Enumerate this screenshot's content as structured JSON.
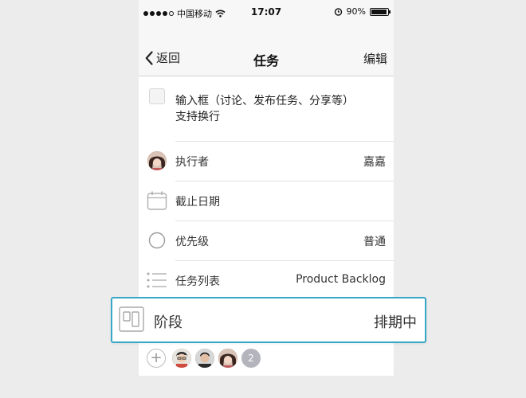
{
  "status_bar": {
    "carrier": "中国移动",
    "time": "17:07",
    "battery": "90%",
    "icons": [
      "signal-dots-icon",
      "wifi-icon",
      "alarm-icon",
      "battery-icon"
    ]
  },
  "nav": {
    "back_label": "返回",
    "title": "任务",
    "edit_label": "编辑"
  },
  "task": {
    "input_text": "输入框（讨论、发布任务、分享等）\n支持换行"
  },
  "fields": [
    {
      "label": "执行者",
      "value": "嘉嘉",
      "icon": "assignee-avatar"
    },
    {
      "label": "截止日期",
      "value": "",
      "icon": "calendar-icon"
    },
    {
      "label": "优先级",
      "value": "普通",
      "icon": "priority-circle-icon"
    },
    {
      "label": "任务列表",
      "value": "Product Backlog",
      "icon": "list-icon"
    }
  ],
  "stage": {
    "label": "阶段",
    "value": "排期中",
    "icon": "stage-board-icon"
  },
  "members": {
    "extra_count": "2"
  },
  "colors": {
    "highlight_border": "#36a9c7",
    "page_background": "#ececec",
    "badge": "#b4b4bd"
  }
}
